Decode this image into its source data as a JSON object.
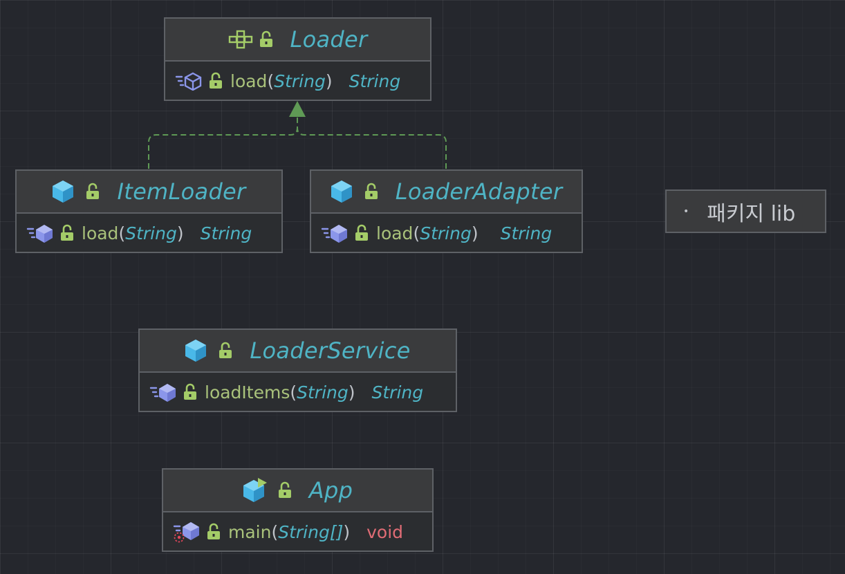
{
  "nodes": {
    "loader": {
      "name": "Loader",
      "method": "load",
      "param": "String",
      "return": "String"
    },
    "item_loader": {
      "name": "ItemLoader",
      "method": "load",
      "param": "String",
      "return": "String"
    },
    "loader_adapter": {
      "name": "LoaderAdapter",
      "method": "load",
      "param": "String",
      "return": "String"
    },
    "loader_service": {
      "name": "LoaderService",
      "method": "loadItems",
      "param": "String",
      "return": "String"
    },
    "app": {
      "name": "App",
      "method": "main",
      "param": "String[]",
      "return": "void"
    }
  },
  "punct": {
    "open": "(",
    "close": ")"
  },
  "package": {
    "label": "패키지 lib",
    "bullet": "•"
  },
  "colors": {
    "background": "#25272d",
    "node_border": "#5e6166",
    "class_name": "#4fb4c5",
    "method_name": "#a9c27b",
    "return_void": "#e06c75",
    "edge": "#5f9a55",
    "class_icon": "#49b8e8",
    "lock_icon": "#a4cc68"
  },
  "icons": {
    "interface": "interface-icon",
    "class": "class-icon",
    "main_class": "main-class-icon",
    "lock": "lock-open-icon",
    "method": "method-icon",
    "method_error": "method-error-icon"
  }
}
